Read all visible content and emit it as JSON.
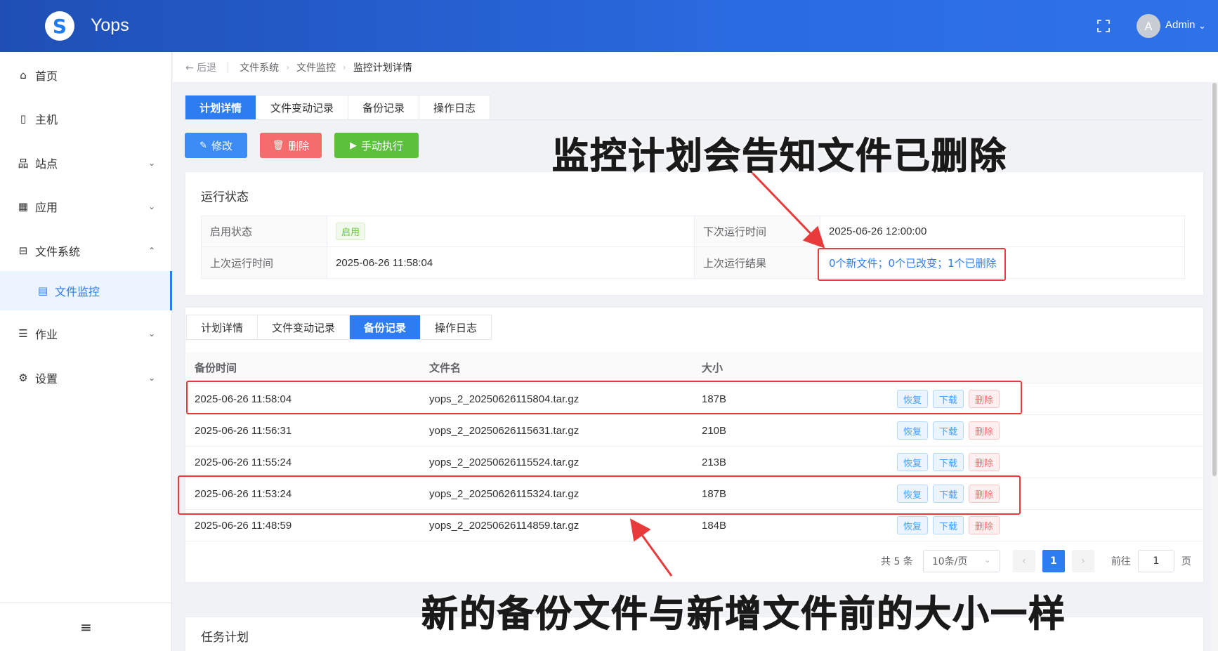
{
  "header": {
    "logo_glyph": "S",
    "app_title": "Yops",
    "avatar_letter": "A",
    "user_name": "Admin"
  },
  "sidebar": {
    "items": [
      {
        "label": "首页",
        "icon": "home-icon",
        "glyph": "⌂"
      },
      {
        "label": "主机",
        "icon": "host-icon",
        "glyph": "▯"
      },
      {
        "label": "站点",
        "icon": "sitemap-icon",
        "glyph": "品",
        "chevron": "⌄"
      },
      {
        "label": "应用",
        "icon": "apps-icon",
        "glyph": "▦",
        "chevron": "⌄"
      },
      {
        "label": "文件系统",
        "icon": "filesystem-icon",
        "glyph": "⊟",
        "chevron": "⌃"
      },
      {
        "label": "文件监控",
        "icon": "file-monitor-icon",
        "glyph": "▤",
        "active": true
      },
      {
        "label": "作业",
        "icon": "job-icon",
        "glyph": "☰",
        "chevron": "⌄"
      },
      {
        "label": "设置",
        "icon": "settings-icon",
        "glyph": "⚙",
        "chevron": "⌄"
      }
    ],
    "collapse_glyph": "≡"
  },
  "breadcrumb": {
    "back": "← 后退",
    "items": [
      "文件系统",
      "文件监控",
      "监控计划详情"
    ],
    "sep": "›"
  },
  "top_tabs": [
    "计划详情",
    "文件变动记录",
    "备份记录",
    "操作日志"
  ],
  "actions": {
    "edit": "修改",
    "delete": "删除",
    "run": "手动执行"
  },
  "status_card": {
    "title": "运行状态",
    "enable_label": "启用状态",
    "enable_value": "启用",
    "next_run_label": "下次运行时间",
    "next_run_value": "2025-06-26 12:00:00",
    "last_run_label": "上次运行时间",
    "last_run_value": "2025-06-26 11:58:04",
    "last_result_label": "上次运行结果",
    "last_result_value": "0个新文件；0个已改变；1个已删除"
  },
  "inner_tabs": [
    "计划详情",
    "文件变动记录",
    "备份记录",
    "操作日志"
  ],
  "backup_table": {
    "headers": [
      "备份时间",
      "文件名",
      "大小"
    ],
    "rows": [
      {
        "time": "2025-06-26 11:58:04",
        "file": "yops_2_20250626115804.tar.gz",
        "size": "187B"
      },
      {
        "time": "2025-06-26 11:56:31",
        "file": "yops_2_20250626115631.tar.gz",
        "size": "210B"
      },
      {
        "time": "2025-06-26 11:55:24",
        "file": "yops_2_20250626115524.tar.gz",
        "size": "213B"
      },
      {
        "time": "2025-06-26 11:53:24",
        "file": "yops_2_20250626115324.tar.gz",
        "size": "187B"
      },
      {
        "time": "2025-06-26 11:48:59",
        "file": "yops_2_20250626114859.tar.gz",
        "size": "184B"
      }
    ],
    "restore_label": "恢复",
    "download_label": "下载",
    "delete_label": "删除"
  },
  "pagination": {
    "total": "共 5 条",
    "page_size": "10条/页",
    "current": "1",
    "goto_label": "前往",
    "goto_value": "1",
    "page_unit": "页"
  },
  "task_card": {
    "title": "任务计划"
  },
  "annotations": {
    "top": "监控计划会告知文件已删除",
    "bottom": "新的备份文件与新增文件前的大小一样"
  },
  "colors": {
    "primary": "#2d7cf2",
    "danger": "#f56c6c",
    "success": "#67c23a",
    "annotation_red": "#e83a3a"
  }
}
